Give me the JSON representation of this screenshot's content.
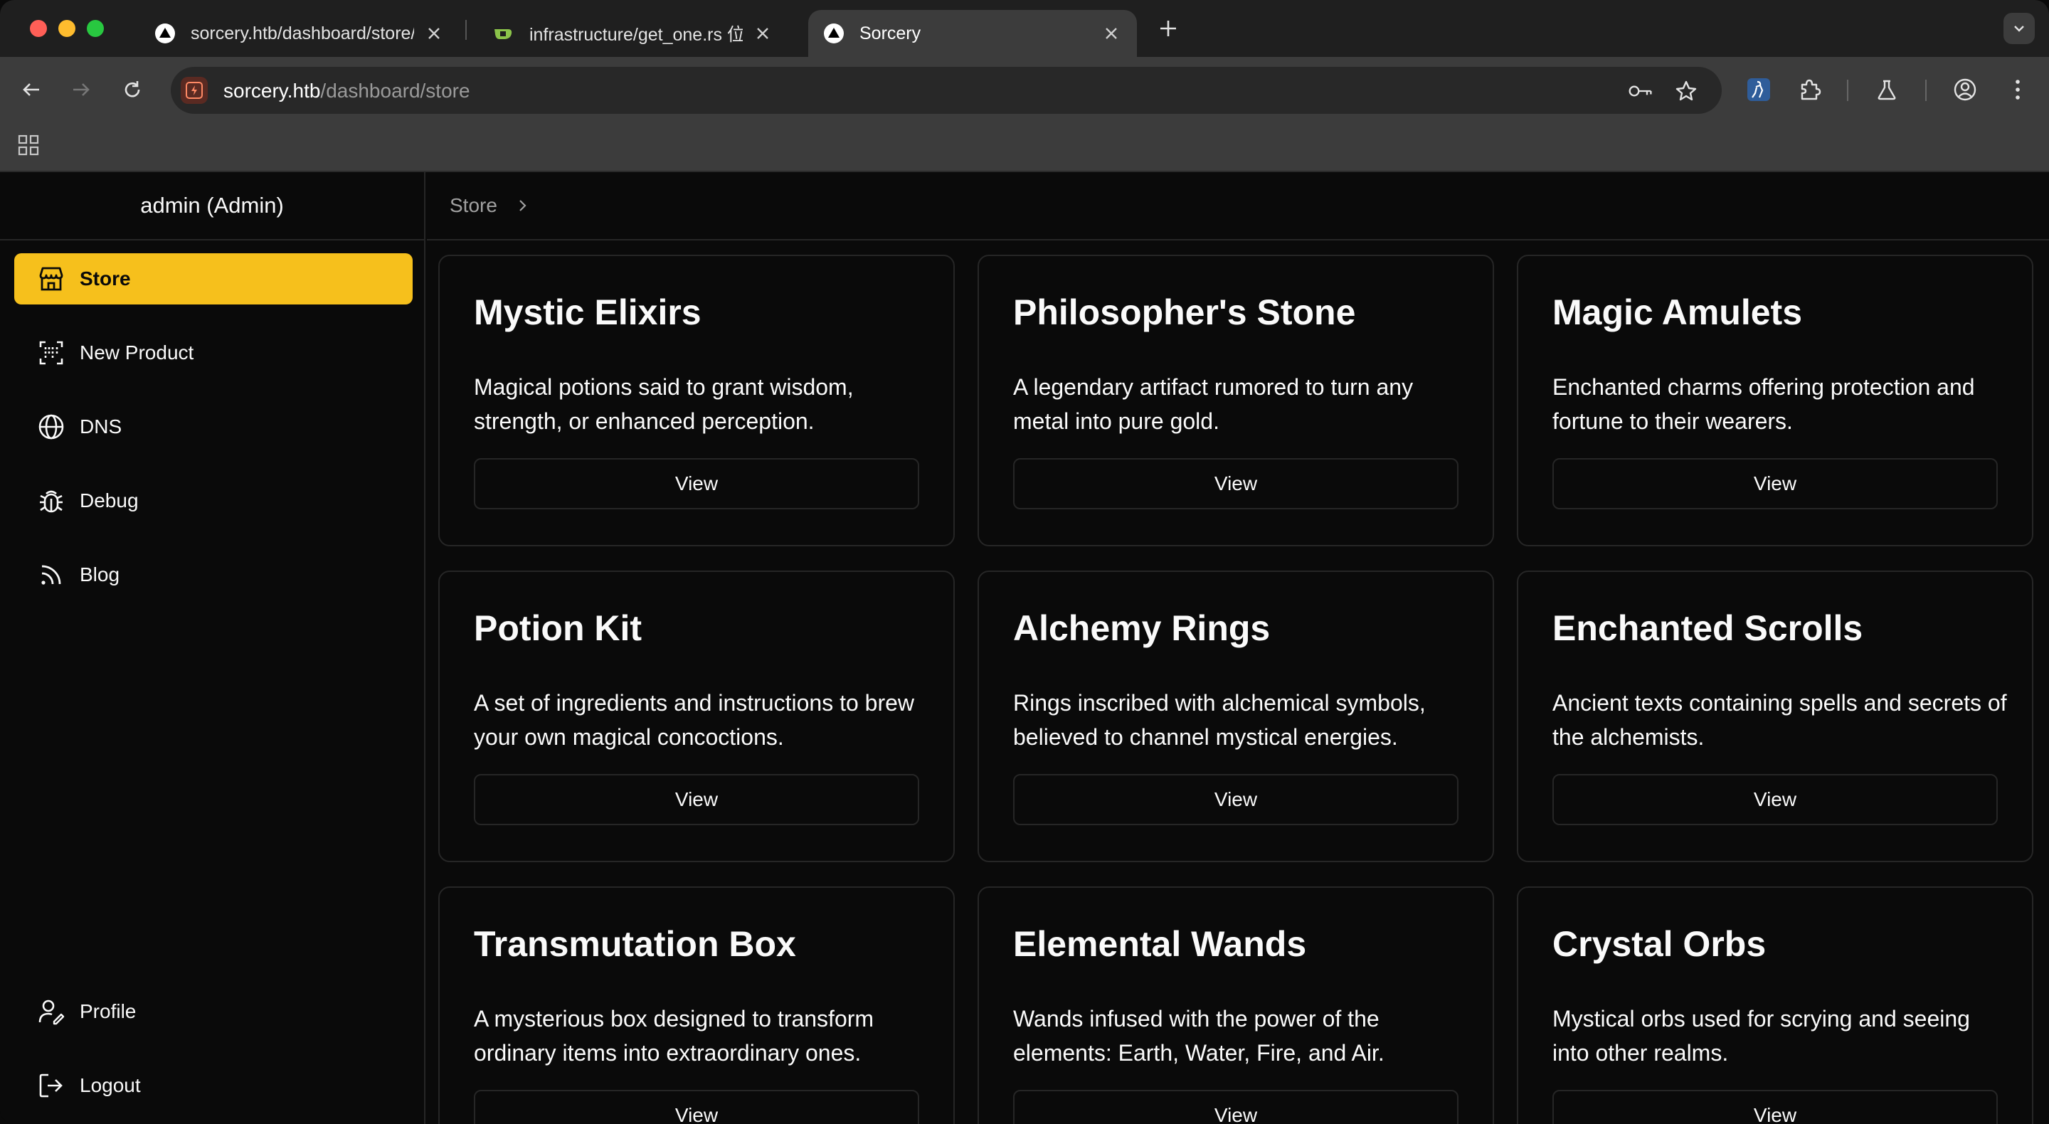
{
  "browser": {
    "tabs": [
      {
        "title": "sorcery.htb/dashboard/store/",
        "active": false
      },
      {
        "title": "infrastructure/get_one.rs 位于",
        "active": false
      },
      {
        "title": "Sorcery",
        "active": true
      }
    ],
    "url_host": "sorcery.htb",
    "url_path": "/dashboard/store"
  },
  "sidebar": {
    "user_label": "admin (Admin)",
    "items": [
      {
        "label": "Store",
        "icon": "store-icon",
        "active": true
      },
      {
        "label": "New Product",
        "icon": "scan-icon",
        "active": false
      },
      {
        "label": "DNS",
        "icon": "globe-icon",
        "active": false
      },
      {
        "label": "Debug",
        "icon": "bug-icon",
        "active": false
      },
      {
        "label": "Blog",
        "icon": "rss-icon",
        "active": false
      }
    ],
    "bottom_items": [
      {
        "label": "Profile",
        "icon": "user-pen-icon"
      },
      {
        "label": "Logout",
        "icon": "logout-icon"
      }
    ]
  },
  "breadcrumb": {
    "current": "Store"
  },
  "products": [
    {
      "name": "Mystic Elixirs",
      "description": "Magical potions said to grant wisdom, strength, or enhanced perception.",
      "button": "View"
    },
    {
      "name": "Philosopher's Stone",
      "description": "A legendary artifact rumored to turn any metal into pure gold.",
      "button": "View"
    },
    {
      "name": "Magic Amulets",
      "description": "Enchanted charms offering protection and fortune to their wearers.",
      "button": "View"
    },
    {
      "name": "Potion Kit",
      "description": "A set of ingredients and instructions to brew your own magical concoctions.",
      "button": "View"
    },
    {
      "name": "Alchemy Rings",
      "description": "Rings inscribed with alchemical symbols, believed to channel mystical energies.",
      "button": "View"
    },
    {
      "name": "Enchanted Scrolls",
      "description": "Ancient texts containing spells and secrets of the alchemists.",
      "button": "View"
    },
    {
      "name": "Transmutation Box",
      "description": "A mysterious box designed to transform ordinary items into extraordinary ones.",
      "button": "View"
    },
    {
      "name": "Elemental Wands",
      "description": "Wands infused with the power of the elements: Earth, Water, Fire, and Air.",
      "button": "View"
    },
    {
      "name": "Crystal Orbs",
      "description": "Mystical orbs used for scrying and seeing into other realms.",
      "button": "View"
    }
  ],
  "colors": {
    "accent": "#f6c01c",
    "background": "#0a0a0a",
    "border": "#262626"
  }
}
